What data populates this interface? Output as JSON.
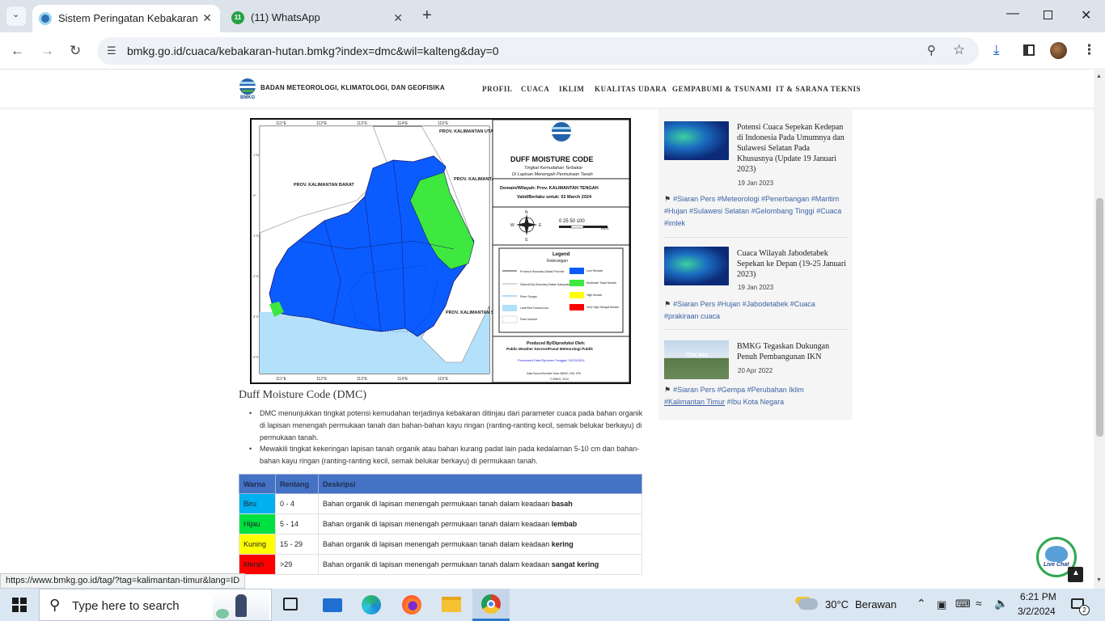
{
  "browser": {
    "tabs": [
      {
        "title": "Sistem Peringatan Kebakaran H",
        "active": true
      },
      {
        "title": "(11) WhatsApp",
        "active": false
      }
    ],
    "url": "bmkg.go.id/cuaca/kebakaran-hutan.bmkg?index=dmc&wil=kalteng&day=0",
    "status_url": "https://www.bmkg.go.id/tag/?tag=kalimantan-timur&lang=ID",
    "whatsapp_badge": "11",
    "new_tab": "+"
  },
  "site": {
    "brand": "BADAN METEOROLOGI, KLIMATOLOGI, DAN GEOFISIKA",
    "logo_text": "BMKG",
    "nav": [
      "PROFIL",
      "CUACA",
      "IKLIM",
      "KUALITAS UDARA",
      "GEMPABUMI & TSUNAMI",
      "IT & SARANA TEKNIS"
    ]
  },
  "map": {
    "title": "DUFF MOISTURE CODE",
    "subtitle1": "Tingkat Kemudahan Terbakar",
    "subtitle2": "Di Lapisan Menengah Permukaan Tanah",
    "domain": "Domain/Wilayah: Prov. KALIMANTAN TENGAH",
    "valid": "Valid/Berlaku untuk: 02 March 2024",
    "scale": "0  25 50      100",
    "scale_unit": "Km",
    "compass": {
      "n": "N",
      "s": "S",
      "e": "E",
      "w": "W"
    },
    "legend_title": "Legend",
    "legend_subtitle": "Keterangan",
    "legend_left": [
      "Province Boundary Batas Provinsi",
      "District/City Boundary Batas Kabupaten/Kota",
      "River Sungai",
      "Lake/Sea Danau/Laut",
      "Peat Gambut"
    ],
    "legend_right": [
      "Low Rendah",
      "Moderate Tidak Mudah",
      "High Mudah",
      "Very High Sangat Mudah"
    ],
    "produced": "Produced By/Diproduksi Oleh:",
    "producer": "Public Weather Service/Pusat Meteorologi Publik",
    "processed": "Processed Date/Diproses Tanggal: 02/03/2024",
    "source": "Data Source/Sumber Data: BMKG, BIG, IPB",
    "copyright": "© BMKG, 2024",
    "labels": {
      "kalbar": "PROV. KALIMANTAN BARAT",
      "kaltara": "PROV. KALIMANTAN UTARA",
      "kaltim": "PROV. KALIMANTAN TIMUR",
      "kalsel": "PROV. KALIMANTAN SELATAN"
    },
    "lon_ticks": [
      "111°E",
      "112°E",
      "113°E",
      "114°E",
      "115°E"
    ],
    "lat_ticks": [
      "1°N",
      "0°",
      "1°S",
      "2°S",
      "3°S",
      "4°S"
    ]
  },
  "article": {
    "heading": "Duff Moisture Code (DMC)",
    "bullets": [
      "DMC menunjukkan tingkat potensi kemudahan terjadinya kebakaran ditinjau dari parameter cuaca pada bahan organik di lapisan menengah permukaan tanah dan bahan-bahan kayu ringan (ranting-ranting kecil, semak belukar berkayu) di permukaan tanah.",
      "Mewakili tingkat kekeringan lapisan tanah organik atau bahan kurang padat lain pada kedalaman 5-10 cm dan bahan-bahan kayu ringan (ranting-ranting kecil, semak belukar berkayu) di permukaan tanah."
    ],
    "table": {
      "headers": [
        "Warna",
        "Rentang",
        "Deskripsi"
      ],
      "rows": [
        {
          "warna": "Biru",
          "rentang": "0 - 4",
          "desc": "Bahan organik di lapisan menengah permukaan tanah dalam keadaan",
          "bold": "basah",
          "color": "#00b0f0"
        },
        {
          "warna": "Hijau",
          "rentang": "5 - 14",
          "desc": "Bahan organik di lapisan menengah permukaan tanah dalam keadaan",
          "bold": "lembab",
          "color": "#00e040"
        },
        {
          "warna": "Kuning",
          "rentang": "15 - 29",
          "desc": "Bahan organik di lapisan menengah permukaan tanah dalam keadaan",
          "bold": "kering",
          "color": "#ffff00"
        },
        {
          "warna": "Merah",
          "rentang": ">29",
          "desc": "Bahan organik di lapisan menengah permukaan tanah dalam keadaan",
          "bold": "sangat kering",
          "color": "#ff0000"
        }
      ]
    }
  },
  "sidebar": {
    "posts": [
      {
        "title": "Potensi Cuaca Sepekan Kedepan di Indonesia Pada Umumnya dan Sulawesi Selatan Pada Khususnya (Update 19 Januari 2023)",
        "date": "19 Jan 2023",
        "tags": [
          "#Siaran Pers",
          "#Meteorologi",
          "#Penerbangan",
          "#Maritim",
          "#Hujan",
          "#Sulawesi Selatan",
          "#Gelombang Tinggi",
          "#Cuaca",
          "#imlek"
        ]
      },
      {
        "title": "Cuaca Wilayah Jabodetabek Sepekan ke Depan (19-25 Januari 2023)",
        "date": "19 Jan 2023",
        "tags": [
          "#Siaran Pers",
          "#Hujan",
          "#Jabodetabek",
          "#Cuaca",
          "#prakiraan cuaca"
        ]
      },
      {
        "title": "BMKG Tegaskan Dukungan Penuh Pembangunan IKN",
        "date": "20 Apr 2022",
        "tags": [
          "#Siaran Pers",
          "#Gempa",
          "#Perubahan Iklim",
          "#Kalimantan Timur",
          "#Ibu Kota Negara"
        ],
        "img_text": "TITIK NOL"
      }
    ]
  },
  "livechat": {
    "label": "Live Chat"
  },
  "taskbar": {
    "search_placeholder": "Type here to search",
    "weather_temp": "30°C",
    "weather_desc": "Berawan",
    "time": "6:21 PM",
    "date": "3/2/2024",
    "notif_count": "2"
  },
  "colors": {
    "tab_strip": "#dde3ea",
    "table_header": "#4472c4",
    "link": "#3b62a5",
    "map_low": "#0a5cff",
    "map_moderate": "#3ee83e",
    "sea": "#b3e0fa"
  }
}
